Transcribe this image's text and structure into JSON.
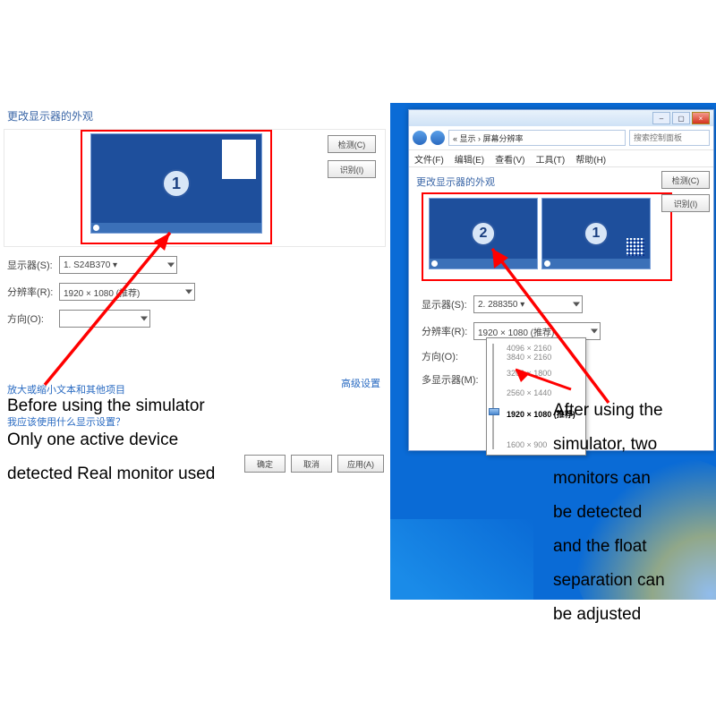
{
  "caption_before": "Before using the simulator\nOnly one active device\ndetected Real monitor used",
  "caption_after": "After using the\nsimulator, two\nmonitors can\nbe detected\nand the float\nseparation can\nbe adjusted",
  "before": {
    "title": "更改显示器的外观",
    "detect_btn": "检测(C)",
    "identify_btn": "识别(I)",
    "monitor_num": "1",
    "field_display": "显示器(S):",
    "val_display": "1. S24B370 ▾",
    "field_res": "分辨率(R):",
    "val_res": "1920 × 1080 (推荐)",
    "field_orient": "方向(O):",
    "val_orient": " ",
    "adv_link": "高级设置",
    "link1": "放大或缩小文本和其他项目",
    "link2": "我应该使用什么显示设置？",
    "btn_ok": "确定",
    "btn_cancel": "取消",
    "btn_apply": "应用(A)"
  },
  "after": {
    "breadcrumb": "« 显示 › 屏幕分辨率",
    "search_ph": "搜索控制面板",
    "menu": {
      "file": "文件(F)",
      "edit": "编辑(E)",
      "view": "查看(V)",
      "tools": "工具(T)",
      "help": "帮助(H)"
    },
    "title": "更改显示器的外观",
    "detect_btn": "检测(C)",
    "identify_btn": "识别(I)",
    "mon1": "1",
    "mon2": "2",
    "field_display": "显示器(S):",
    "val_display": "2. 288350 ▾",
    "field_res": "分辨率(R):",
    "val_res": "1920 × 1080 (推荐)",
    "field_orient": "方向(O):",
    "field_multi": "多显示器(M):",
    "res_options": {
      "r0": "4096 × 2160",
      "r1": "3840 × 2160",
      "r2": "3200 × 1800",
      "r3": "2560 × 1440",
      "r4": "1920 × 1080 (推荐)",
      "r5": "1600 × 900"
    }
  }
}
